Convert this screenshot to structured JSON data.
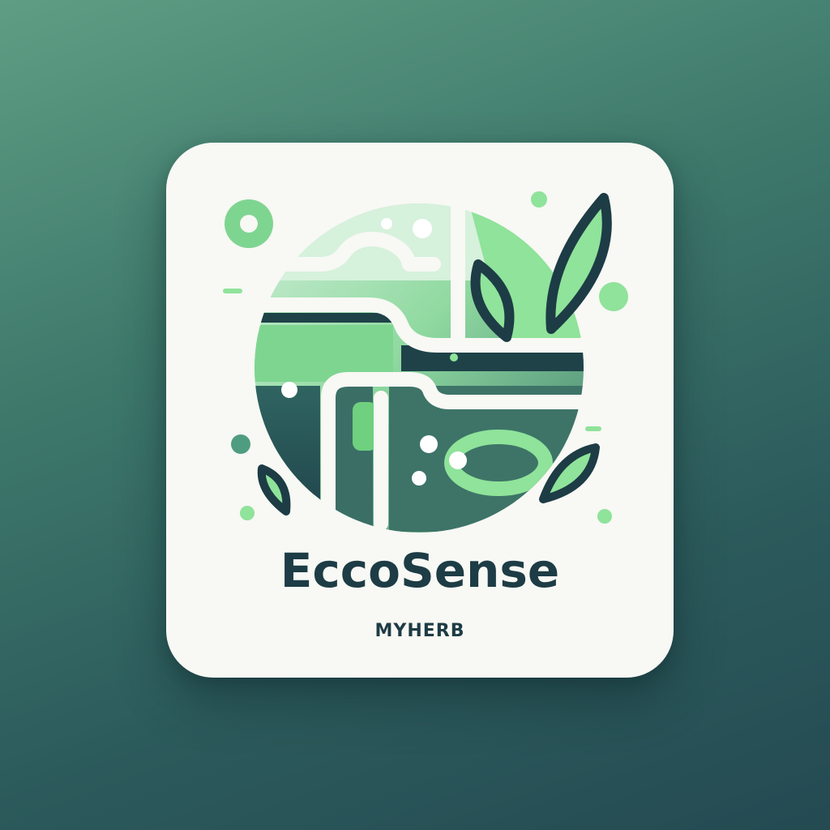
{
  "logo": {
    "name": "EccoSense",
    "tagline": "MYHERB",
    "graphic": "globe-with-leaves-icon"
  },
  "colors": {
    "background_top": "#5f9e84",
    "background_bottom": "#244a52",
    "tile": "#f8f8f4",
    "dark": "#1d3c45",
    "green_light": "#8fe39a",
    "green_mid": "#6fd07f",
    "green_pale": "#c9ecd3",
    "teal_dark": "#2d5c5e"
  }
}
